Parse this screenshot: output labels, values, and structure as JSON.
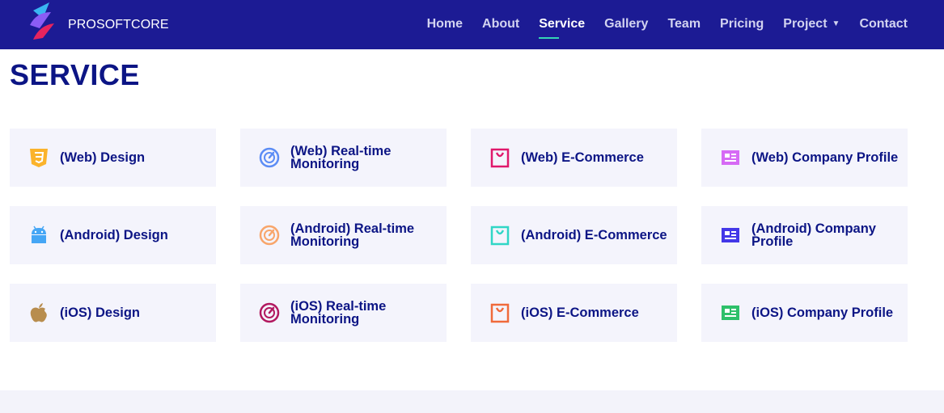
{
  "brand": {
    "name": "PROSOFTCORE"
  },
  "nav": {
    "items": [
      {
        "label": "Home"
      },
      {
        "label": "About"
      },
      {
        "label": "Service"
      },
      {
        "label": "Gallery"
      },
      {
        "label": "Team"
      },
      {
        "label": "Pricing"
      },
      {
        "label": "Project"
      },
      {
        "label": "Contact"
      }
    ],
    "active": "Service"
  },
  "page": {
    "title": "SERVICE"
  },
  "services": [
    {
      "label": "(Web) Design",
      "icon": "css3-icon",
      "color": "#fbb32b"
    },
    {
      "label": "(Web) Real-time Monitoring",
      "icon": "speedometer-icon",
      "color": "#5b8cf5"
    },
    {
      "label": "(Web) E-Commerce",
      "icon": "shopping-bag-icon",
      "color": "#e0186b"
    },
    {
      "label": "(Web) Company Profile",
      "icon": "profile-card-icon",
      "color": "#d66af5"
    },
    {
      "label": "(Android) Design",
      "icon": "android-icon",
      "color": "#45a6f5"
    },
    {
      "label": "(Android) Real-time Monitoring",
      "icon": "speedometer-icon",
      "color": "#f8a56a"
    },
    {
      "label": "(Android) E-Commerce",
      "icon": "shopping-bag-icon",
      "color": "#30d6c6"
    },
    {
      "label": "(Android) Company Profile",
      "icon": "profile-card-icon",
      "color": "#4337e8"
    },
    {
      "label": "(iOS) Design",
      "icon": "apple-icon",
      "color": "#b88d4e"
    },
    {
      "label": "(iOS) Real-time Monitoring",
      "icon": "speedometer-icon",
      "color": "#b2185f"
    },
    {
      "label": "(iOS) E-Commerce",
      "icon": "shopping-bag-icon",
      "color": "#f06a3b"
    },
    {
      "label": "(iOS) Company Profile",
      "icon": "profile-card-icon",
      "color": "#2ec06a"
    }
  ]
}
